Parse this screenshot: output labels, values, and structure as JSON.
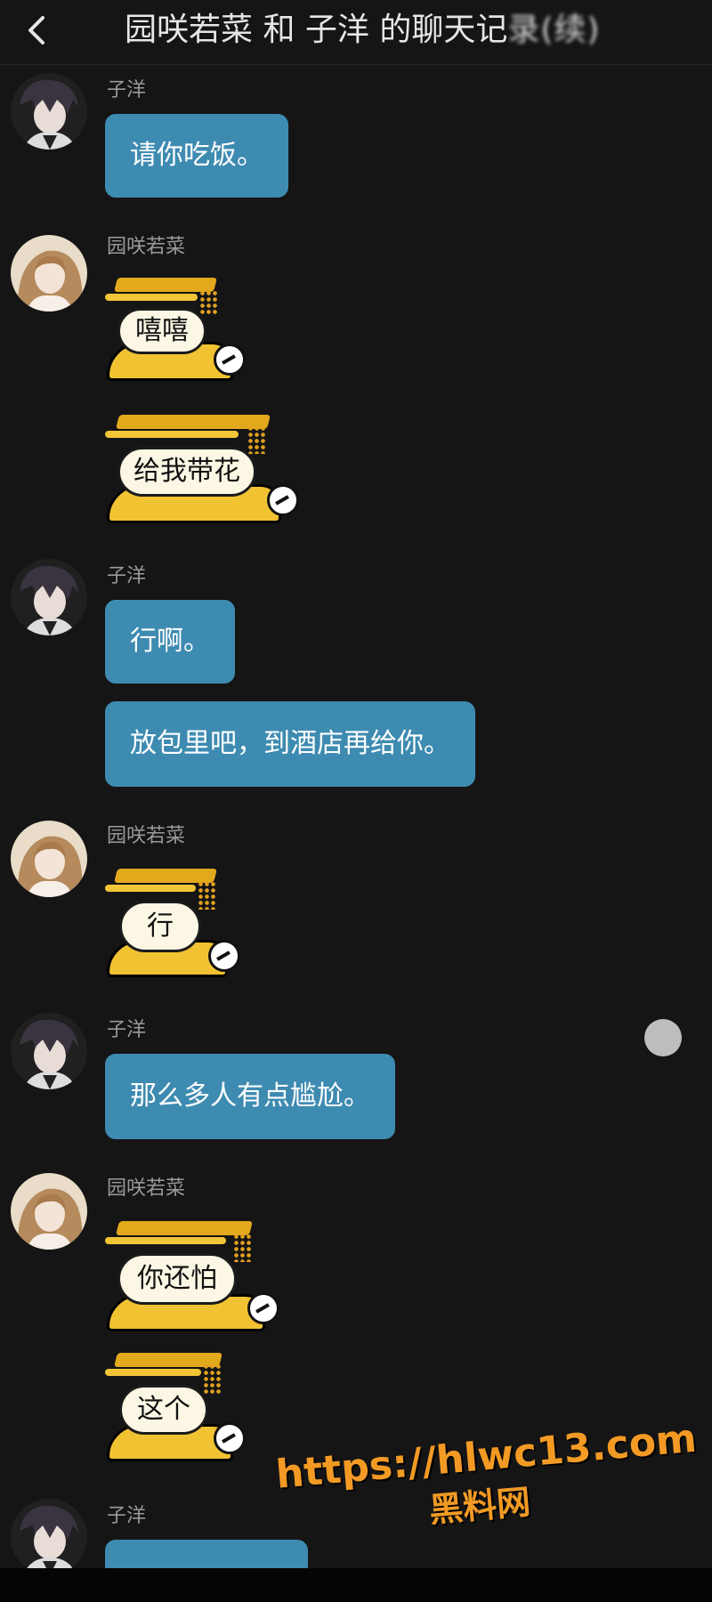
{
  "header": {
    "title_main": "园咲若菜 和 子洋 的聊天记",
    "title_obscured": "录(续)"
  },
  "users": {
    "ziyang": "子洋",
    "wakana": "园咲若菜"
  },
  "messages": [
    {
      "from": "子洋",
      "type": "text",
      "text": "请你吃饭。"
    },
    {
      "from": "园咲若菜",
      "type": "sticker",
      "text": "嘻嘻"
    },
    {
      "from": "园咲若菜",
      "type": "sticker",
      "text": "给我带花"
    },
    {
      "from": "子洋",
      "type": "text",
      "text": "行啊。"
    },
    {
      "from": "子洋",
      "type": "text",
      "text": "放包里吧，到酒店再给你。"
    },
    {
      "from": "园咲若菜",
      "type": "sticker",
      "text": "行"
    },
    {
      "from": "子洋",
      "type": "text",
      "text": "那么多人有点尴尬。"
    },
    {
      "from": "园咲若菜",
      "type": "sticker",
      "text": "你还怕"
    },
    {
      "from": "园咲若菜",
      "type": "sticker",
      "text": "这个"
    }
  ],
  "watermark": {
    "url": "https://hlwc13.com",
    "name": "黑料网"
  },
  "colors": {
    "background": "#151515",
    "bubble": "#3e8bb1",
    "sticker_yellow": "#f1c232",
    "watermark": "#f29a24"
  },
  "icons": {
    "back": "chevron-left-icon"
  }
}
